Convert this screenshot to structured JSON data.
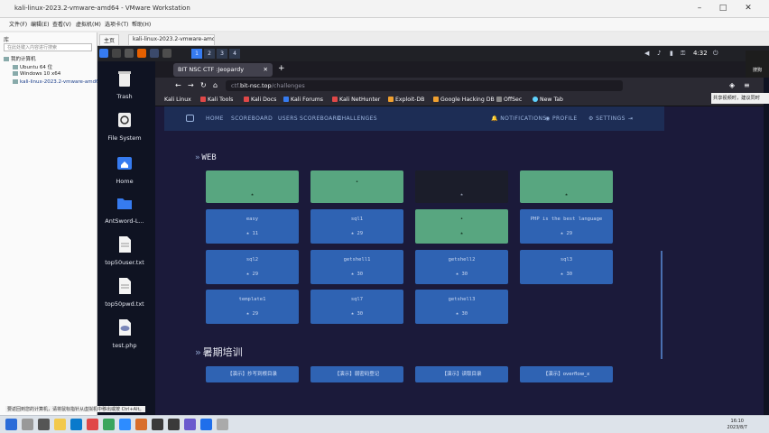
{
  "vm_window": {
    "title": "kali-linux-2023.2-vmware-amd64 - VMware Workstation",
    "menu": [
      "文件(F)",
      "编辑(E)",
      "查看(V)",
      "虚拟机(M)",
      "选项卡(T)",
      "帮助(H)"
    ]
  },
  "library": {
    "header": "库",
    "search_placeholder": "在此处键入内容进行搜索",
    "root": "我的计算机",
    "items": [
      "Ubuntu 64 位",
      "Windows 10 x64",
      "kali-linux-2023.2-vmware-amd64"
    ]
  },
  "vm_tabs": [
    {
      "label": "主页"
    },
    {
      "label": "kali-linux-2023.2-vmware-amd64"
    }
  ],
  "kali_panel": {
    "workspaces": [
      "1",
      "2",
      "3",
      "4"
    ],
    "time": "4:32"
  },
  "desktop_icons": [
    {
      "label": "Trash",
      "icon": "trash-icon"
    },
    {
      "label": "File System",
      "icon": "drive-icon"
    },
    {
      "label": "Home",
      "icon": "home-folder-icon"
    },
    {
      "label": "AntSword-L...",
      "icon": "folder-icon"
    },
    {
      "label": "top50user.txt",
      "icon": "text-file-icon"
    },
    {
      "label": "top50pwd.txt",
      "icon": "text-file-icon"
    },
    {
      "label": "test.php",
      "icon": "php-file-icon"
    }
  ],
  "browser": {
    "tab_title": "BIT NSC CTF :Jeopardy",
    "url_prefix": "ctf.",
    "url_host": "bit-nsc.top",
    "url_path": "/challenges",
    "bookmarks": [
      {
        "label": "Kali Linux",
        "color": "#367bf0"
      },
      {
        "label": "Kali Tools",
        "color": "#e04848"
      },
      {
        "label": "Kali Docs",
        "color": "#e04848"
      },
      {
        "label": "Kali Forums",
        "color": "#367bf0"
      },
      {
        "label": "Kali NetHunter",
        "color": "#e04848"
      },
      {
        "label": "Exploit-DB",
        "color": "#f0a030"
      },
      {
        "label": "Google Hacking DB",
        "color": "#f0a030"
      },
      {
        "label": "OffSec",
        "color": "#888888"
      },
      {
        "label": "New Tab",
        "color": "#5fd3ff"
      }
    ]
  },
  "ctf_nav": {
    "links": [
      "HOME",
      "SCOREBOARD",
      "USERS",
      "SCOREBOARD",
      "CHALLENGES"
    ],
    "right": [
      "NOTIFICATIONS",
      "PROFILE",
      "SETTINGS"
    ]
  },
  "sections": {
    "web_title": "WEB",
    "training_title": "暑期培训"
  },
  "web_challenges_row1": [
    {
      "name": "",
      "points": "",
      "state": "green"
    },
    {
      "name": "",
      "points": "",
      "state": "green"
    },
    {
      "name": "",
      "points": "",
      "state": "dark"
    },
    {
      "name": "",
      "points": "",
      "state": "green"
    }
  ],
  "web_challenges": [
    {
      "name": "easy",
      "points": "★ 11",
      "state": "blue"
    },
    {
      "name": "sql1",
      "points": "★ 29",
      "state": "blue"
    },
    {
      "name": "",
      "points": "",
      "state": "green"
    },
    {
      "name": "PHP is the best language",
      "points": "★ 29",
      "state": "blue"
    },
    {
      "name": "sql2",
      "points": "★ 29",
      "state": "blue"
    },
    {
      "name": "getshell1",
      "points": "★ 30",
      "state": "blue"
    },
    {
      "name": "getshell2",
      "points": "★ 30",
      "state": "blue"
    },
    {
      "name": "sql3",
      "points": "★ 30",
      "state": "blue"
    },
    {
      "name": "template1",
      "points": "★ 29",
      "state": "blue"
    },
    {
      "name": "sql7",
      "points": "★ 30",
      "state": "blue"
    },
    {
      "name": "getshell3",
      "points": "★ 30",
      "state": "blue"
    }
  ],
  "training": [
    "【演示】抄写到根目录",
    "【演示】弱密码登记",
    "【演示】读取目录",
    "【演示】overflow_x"
  ],
  "windows_taskbar": {
    "status_text": "要返回到您的计算机，请将鼠标指针从虚拟机中移出或按 Ctrl+Alt。",
    "time": "16:10",
    "date": "2023/8/7"
  },
  "ime": {
    "label": "搜狗"
  },
  "popup": {
    "text": "共享视频时，建议同时"
  }
}
